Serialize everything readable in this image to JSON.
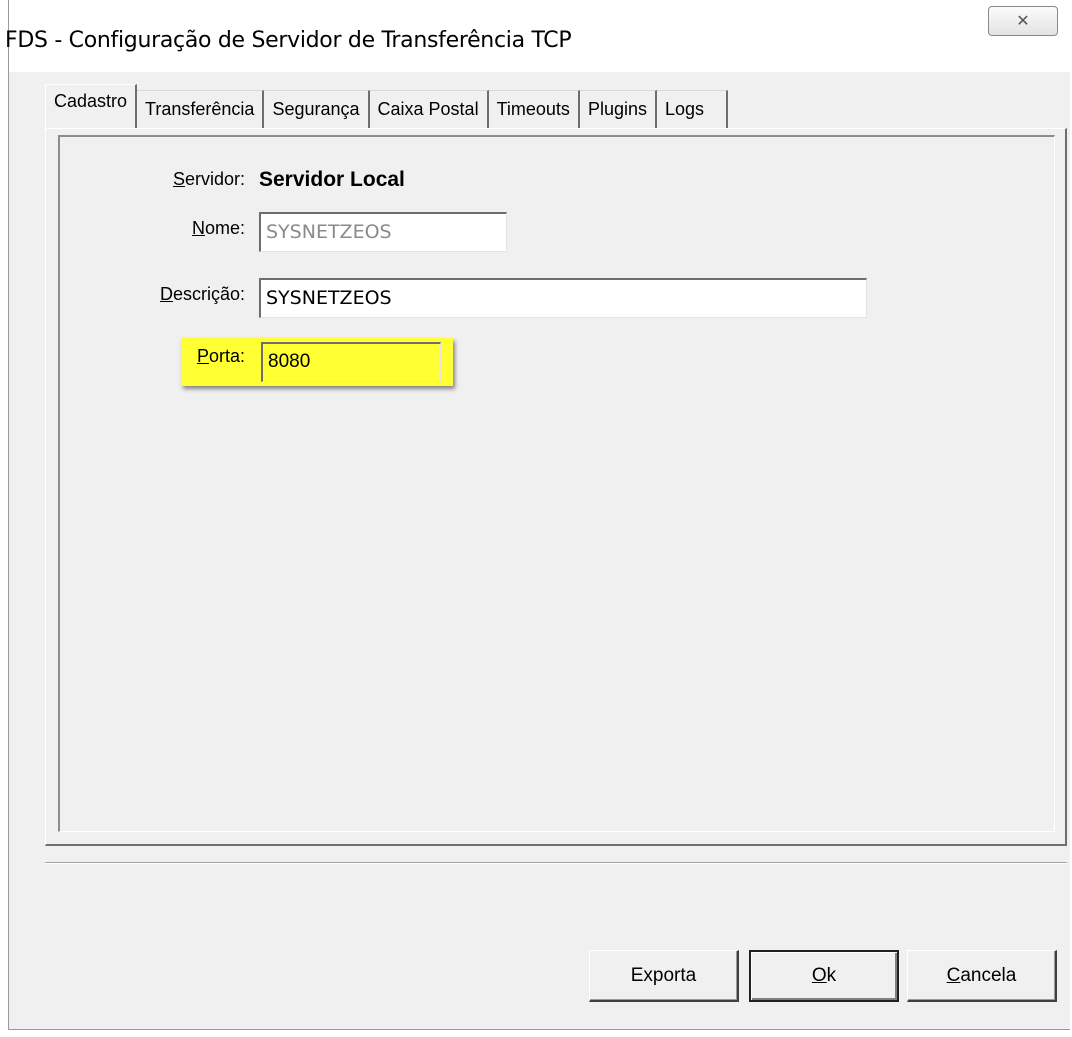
{
  "window": {
    "title": "FDS - Configuração de Servidor de Transferência TCP",
    "close_symbol": "✕"
  },
  "tabs": [
    {
      "label": "Cadastro",
      "active": true
    },
    {
      "label": "Transferência",
      "active": false
    },
    {
      "label": "Segurança",
      "active": false
    },
    {
      "label": "Caixa Postal",
      "active": false
    },
    {
      "label": "Timeouts",
      "active": false
    },
    {
      "label": "Plugins",
      "active": false
    },
    {
      "label": "Logs",
      "active": false
    }
  ],
  "form": {
    "servidor": {
      "label_first": "S",
      "label_rest": "ervidor:",
      "value": "Servidor Local"
    },
    "nome": {
      "label_first": "N",
      "label_rest": "ome:",
      "value": "SYSNETZEOS"
    },
    "descricao": {
      "label_first": "D",
      "label_rest": "escrição:",
      "value": "SYSNETZEOS"
    },
    "porta": {
      "label_first": "P",
      "label_rest": "orta:",
      "value": "8080"
    }
  },
  "buttons": {
    "exporta": "Exporta",
    "ok_first": "O",
    "ok_rest": "k",
    "cancela_first": "C",
    "cancela_rest": "ancela"
  },
  "colors": {
    "highlight": "#ffff33",
    "window_bg": "#f0f0f0"
  },
  "icons": {
    "close": "close-icon"
  }
}
